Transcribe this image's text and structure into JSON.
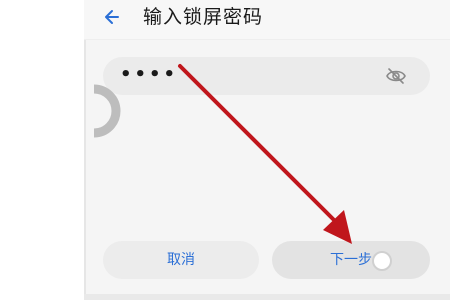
{
  "header": {
    "title": "输入锁屏密码",
    "back_icon": "arrow-left-icon"
  },
  "password": {
    "masked_value": "••••",
    "visibility_icon": "eye-off-icon"
  },
  "buttons": {
    "cancel_label": "取消",
    "next_label": "下一步"
  },
  "colors": {
    "accent": "#2b6fd6",
    "annotation_arrow": "#c0161c",
    "field_bg": "#ebebeb"
  }
}
